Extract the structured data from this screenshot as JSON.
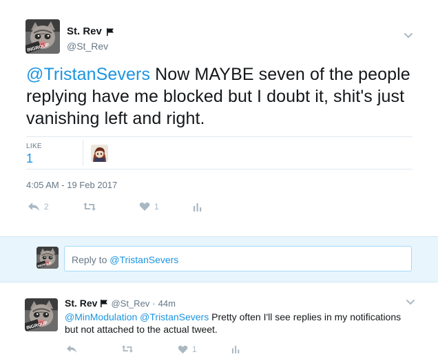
{
  "tweet": {
    "author_name": "St. Rev",
    "author_handle": "@St_Rev",
    "avatar_badge": "INGROUP",
    "mention": "@TristanSevers",
    "text": " Now MAYBE seven of the people replying have me blocked but I doubt it, shit's just vanishing left and right.",
    "likes_label": "LIKE",
    "likes_count": "1",
    "timestamp": "4:05 AM - 19 Feb 2017",
    "reply_count": "2",
    "retweet_count": "",
    "like_count": "1"
  },
  "reply_box": {
    "prefix": "Reply to ",
    "mention": "@TristanSevers",
    "avatar_badge": "INGROUP"
  },
  "reply_tweet": {
    "author_name": "St. Rev",
    "author_handle": "@St_Rev",
    "separator": "·",
    "time": "44m",
    "avatar_badge": "INGROUP",
    "mention_1": "@MinModulation",
    "mention_2": "@TristanSevers",
    "text": " Pretty often I'll see replies in my notifications but not attached to the actual tweet.",
    "like_count": "1"
  },
  "colors": {
    "link": "#1b95e0",
    "muted": "#657786",
    "action": "#aab8c2",
    "reply_band": "#e8f5fd"
  },
  "icons": [
    "chevron-down-icon",
    "flag-icon",
    "reply-icon",
    "retweet-icon",
    "heart-icon",
    "analytics-icon"
  ]
}
